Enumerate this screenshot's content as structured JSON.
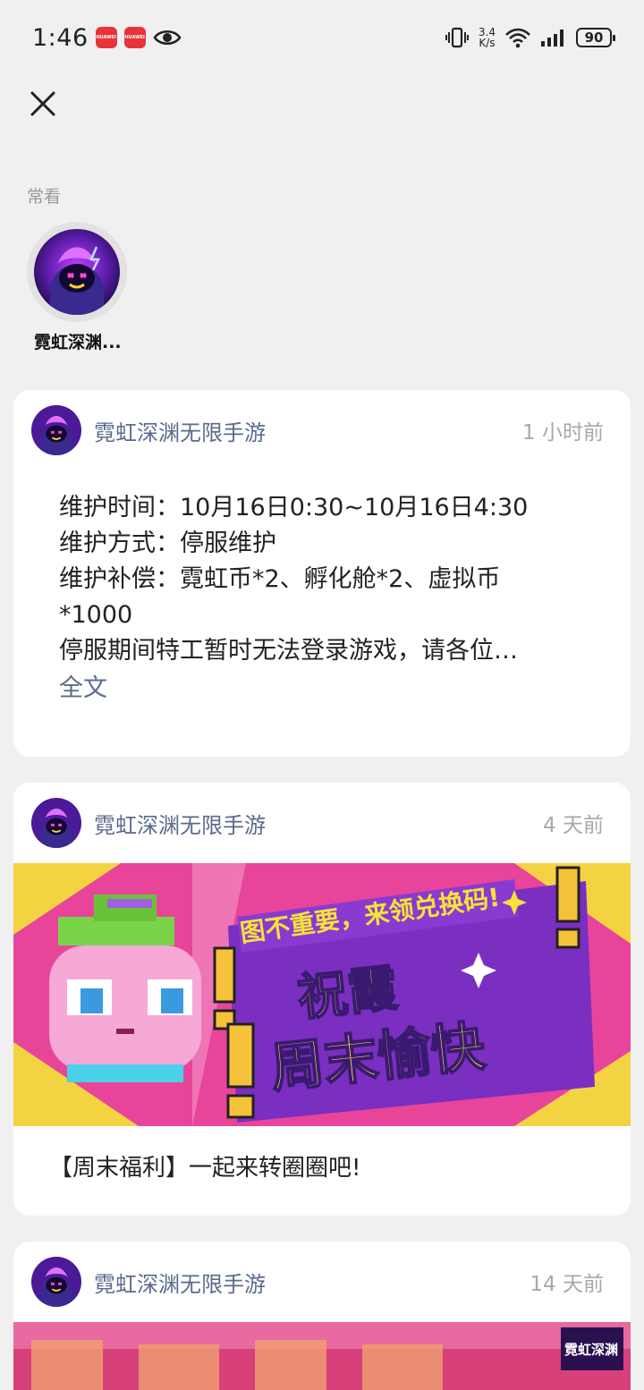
{
  "status_bar": {
    "time": "1:46",
    "app_icon_label": "HUAWEI",
    "net_speed_value": "3.4",
    "net_speed_unit": "K/s",
    "battery": "90"
  },
  "frequent": {
    "label": "常看",
    "items": [
      {
        "name": "霓虹深渊..."
      }
    ]
  },
  "posts": [
    {
      "author": "霓虹深渊无限手游",
      "time": "1 小时前",
      "lines": [
        "维护时间：10月16日0:30~10月16日4:30",
        "维护方式：停服维护",
        "维护补偿：霓虹币*2、孵化舱*2、虚拟币",
        "*1000",
        "停服期间特工暂时无法登录游戏，请各位…"
      ],
      "full_link": "全文"
    },
    {
      "author": "霓虹深渊无限手游",
      "time": "4 天前",
      "banner_text": {
        "tagline": "图不重要，来领兑换码!",
        "line1": "祝霞",
        "line2": "周末愉快"
      },
      "caption": "【周末福利】一起来转圈圈吧!"
    },
    {
      "author": "霓虹深渊无限手游",
      "time": "14 天前",
      "banner_logo": "霓虹深渊"
    }
  ],
  "colors": {
    "author": "#5a6b8c",
    "timestamp": "#a8a8a8",
    "banner_pink": "#e8459a",
    "banner_purple": "#7a2fc0",
    "banner_yellow": "#f5e23a"
  }
}
